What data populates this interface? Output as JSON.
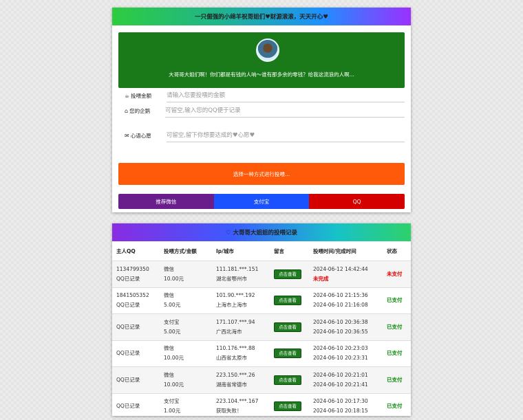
{
  "donate_card": {
    "title": "一只倔强的小绵羊祝哥姐们♥财源滚滚，天天开心♥",
    "banner_text": "大哥哥大姐们啊！你们都是有钱的人呐～谁有那多余的零钱？给我这流浪的人啊...",
    "amount": {
      "label": "投喂金额",
      "placeholder": "请输入您要投喂的金额",
      "icon": "coffee-cup-icon"
    },
    "qq": {
      "label": "您的企鹅",
      "placeholder": "可留空,输入您的QQ便于记录",
      "icon": "penguin-icon"
    },
    "wish": {
      "label": "心语心愿",
      "placeholder": "可留空,留下你想要达成的♥心愿♥",
      "icon": "envelope-icon"
    },
    "pay_button": "选择一种方式进行投喂...",
    "methods": {
      "wechat": "推荐微信",
      "alipay": "支付宝",
      "qq": "QQ"
    }
  },
  "records_card": {
    "title": "♡ 大哥哥大姐姐的投喂记录",
    "columns": [
      "主人QQ",
      "投喂方式/金额",
      "Ip/城市",
      "留言",
      "投喂时间/完成时间",
      "状态"
    ],
    "view_label": "点击查看",
    "rows": [
      {
        "qq": "1134799350",
        "qq_note": "QQ已记录",
        "method": "微信",
        "amount": "10.00元",
        "ip": "111.181.***.151",
        "city": "湖北省鄂州市",
        "time": "2024-06-12 14:42:44",
        "done": "未完成",
        "status": "未支付"
      },
      {
        "qq": "1841505352",
        "qq_note": "QQ已记录",
        "method": "微信",
        "amount": "5.00元",
        "ip": "101.90.***.192",
        "city": "上海市上海市",
        "time": "2024-06-10 21:15:36",
        "done": "2024-06-10 21:16:08",
        "status": "已支付"
      },
      {
        "qq": "",
        "qq_note": "QQ已记录",
        "method": "支付宝",
        "amount": "5.00元",
        "ip": "171.107.***.94",
        "city": "广西北海市",
        "time": "2024-06-10 20:36:38",
        "done": "2024-06-10 20:36:55",
        "status": "已支付"
      },
      {
        "qq": "",
        "qq_note": "QQ已记录",
        "method": "微信",
        "amount": "10.00元",
        "ip": "110.176.***.88",
        "city": "山西省太原市",
        "time": "2024-06-10 20:23:03",
        "done": "2024-06-10 20:23:31",
        "status": "已支付"
      },
      {
        "qq": "",
        "qq_note": "QQ已记录",
        "method": "微信",
        "amount": "10.00元",
        "ip": "223.150.***.26",
        "city": "湖南省常德市",
        "time": "2024-06-10 20:21:01",
        "done": "2024-06-10 20:21:41",
        "status": "已支付"
      },
      {
        "qq": "",
        "qq_note": "QQ已记录",
        "method": "支付宝",
        "amount": "1.00元",
        "ip": "223.104.***.167",
        "city": "获取失败！",
        "time": "2024-06-10 20:17:30",
        "done": "2024-06-10 20:18:15",
        "status": "已支付"
      }
    ]
  }
}
